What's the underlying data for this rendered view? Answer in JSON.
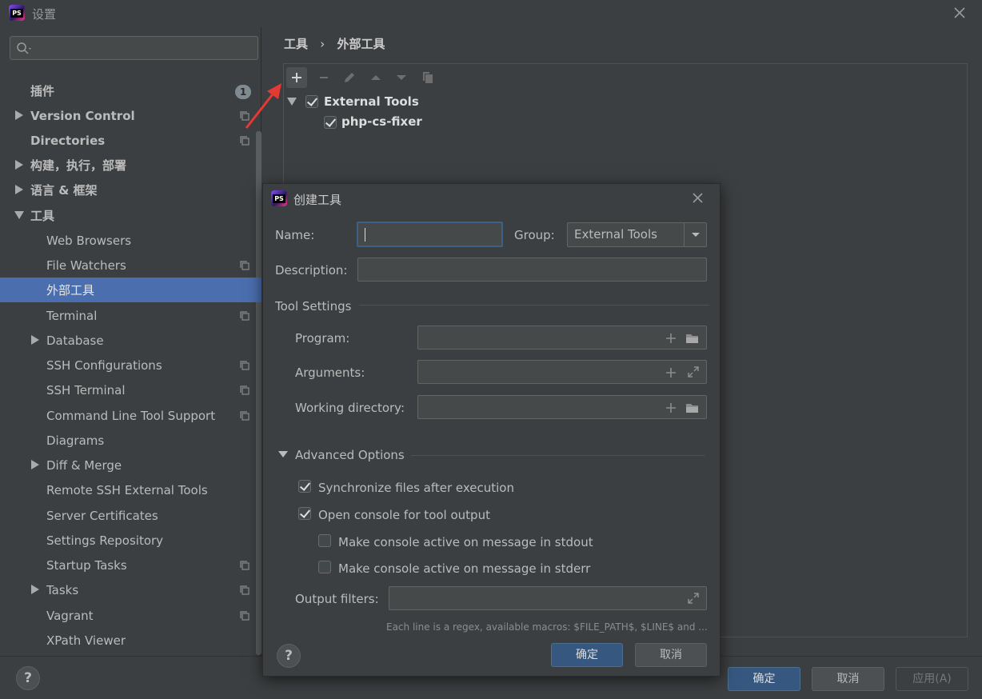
{
  "window": {
    "title": "设置",
    "logo_text": "PS"
  },
  "sidebar": {
    "search_placeholder": "",
    "badge": "1",
    "items": [
      {
        "label": "插件",
        "bold": true
      },
      {
        "label": "Version Control",
        "bold": true
      },
      {
        "label": "Directories",
        "bold": true
      },
      {
        "label": "构建，执行，部署",
        "bold": true
      },
      {
        "label": "语言 & 框架",
        "bold": true
      },
      {
        "label": "工具",
        "bold": true
      },
      {
        "label": "Web Browsers"
      },
      {
        "label": "File Watchers"
      },
      {
        "label": "外部工具",
        "selected": true
      },
      {
        "label": "Terminal"
      },
      {
        "label": "Database"
      },
      {
        "label": "SSH Configurations"
      },
      {
        "label": "SSH Terminal"
      },
      {
        "label": "Command Line Tool Support"
      },
      {
        "label": "Diagrams"
      },
      {
        "label": "Diff & Merge"
      },
      {
        "label": "Remote SSH External Tools"
      },
      {
        "label": "Server Certificates"
      },
      {
        "label": "Settings Repository"
      },
      {
        "label": "Startup Tasks"
      },
      {
        "label": "Tasks"
      },
      {
        "label": "Vagrant"
      },
      {
        "label": "XPath Viewer"
      }
    ]
  },
  "breadcrumb": {
    "root": "工具",
    "separator": "›",
    "current": "外部工具"
  },
  "tree": {
    "group_label": "External Tools",
    "group_checked": true,
    "tool_label": "php-cs-fixer",
    "tool_checked": true
  },
  "dialog": {
    "title": "创建工具",
    "name_label": "Name:",
    "name_value": "",
    "group_label": "Group:",
    "group_value": "External Tools",
    "description_label": "Description:",
    "description_value": "",
    "tool_settings_header": "Tool Settings",
    "program_label": "Program:",
    "program_value": "",
    "arguments_label": "Arguments:",
    "arguments_value": "",
    "working_dir_label": "Working directory:",
    "working_dir_value": "",
    "advanced_header": "Advanced Options",
    "sync_files_label": "Synchronize files after execution",
    "sync_files_checked": true,
    "open_console_label": "Open console for tool output",
    "open_console_checked": true,
    "console_stdout_label": "Make console active on message in stdout",
    "console_stdout_checked": false,
    "console_stderr_label": "Make console active on message in stderr",
    "console_stderr_checked": false,
    "output_filters_label": "Output filters:",
    "output_filters_value": "",
    "hint": "Each line is a regex, available macros: $FILE_PATH$, $LINE$ and ...",
    "ok_label": "确定",
    "cancel_label": "取消",
    "help_label": "?"
  },
  "footer": {
    "help_label": "?",
    "ok_label": "确定",
    "cancel_label": "取消",
    "apply_label": "应用(A)"
  },
  "colors": {
    "selection": "#4b6eaf",
    "primary_button": "#365880",
    "background": "#3c3f41",
    "arrow": "#e53935"
  }
}
